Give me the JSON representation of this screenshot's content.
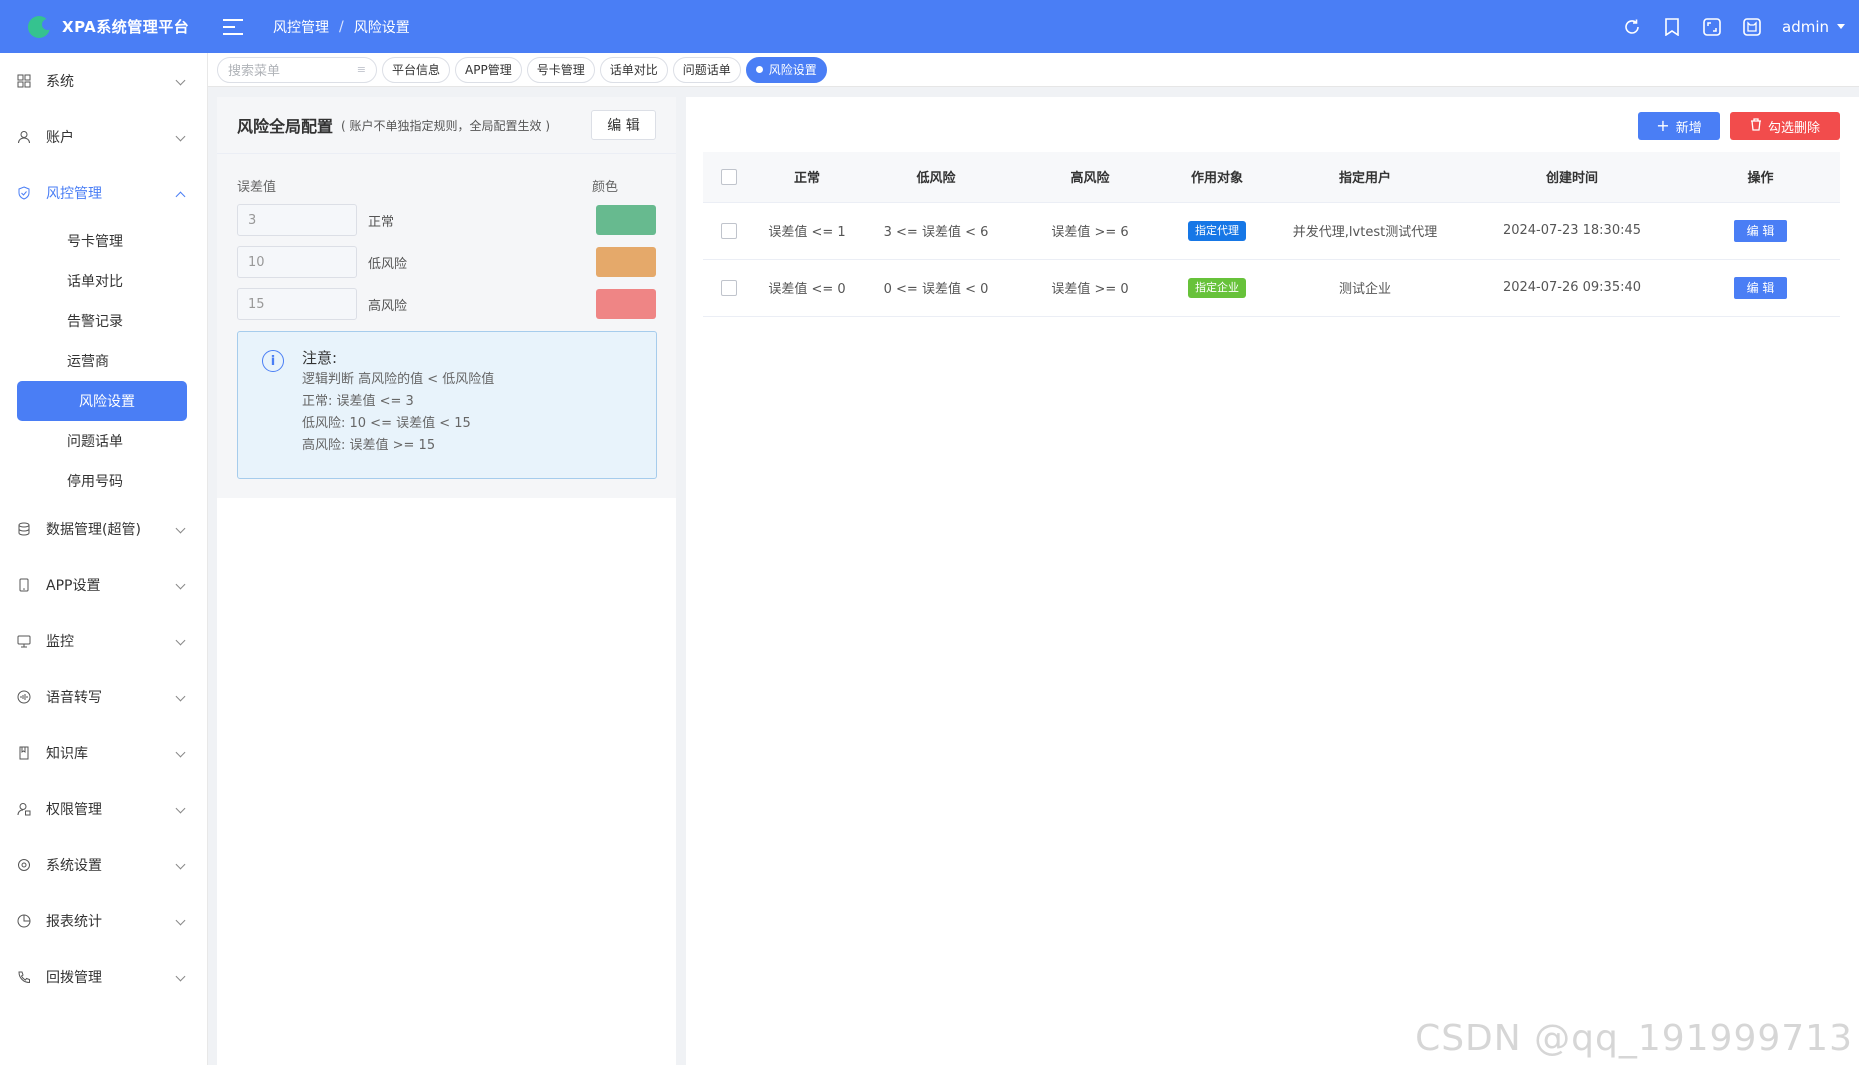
{
  "app": {
    "title": "XPA系统管理平台",
    "brand_color": "#4a7ef5"
  },
  "breadcrumb": [
    "风控管理",
    "风险设置"
  ],
  "header": {
    "user": "admin",
    "icons": [
      "refresh-icon",
      "bookmark-icon",
      "fullscreen-icon",
      "theme-icon"
    ]
  },
  "sidebar": {
    "items": [
      {
        "label": "系统",
        "icon": "grid-icon"
      },
      {
        "label": "账户",
        "icon": "user-icon"
      },
      {
        "label": "风控管理",
        "icon": "shield-icon",
        "open": true,
        "children": [
          "号卡管理",
          "话单对比",
          "告警记录",
          "运营商",
          "风险设置",
          "问题话单",
          "停用号码"
        ],
        "active_child": "风险设置"
      },
      {
        "label": "数据管理(超管)",
        "icon": "database-icon"
      },
      {
        "label": "APP设置",
        "icon": "phone-icon"
      },
      {
        "label": "监控",
        "icon": "monitor-icon"
      },
      {
        "label": "语音转写",
        "icon": "voice-icon"
      },
      {
        "label": "知识库",
        "icon": "book-icon"
      },
      {
        "label": "权限管理",
        "icon": "user-lock-icon"
      },
      {
        "label": "系统设置",
        "icon": "settings-icon"
      },
      {
        "label": "报表统计",
        "icon": "pie-chart-icon"
      },
      {
        "label": "回拨管理",
        "icon": "phone-call-icon"
      }
    ]
  },
  "tabs": {
    "search_placeholder": "搜索菜单",
    "items": [
      "平台信息",
      "APP管理",
      "号卡管理",
      "话单对比",
      "问题话单",
      "风险设置"
    ],
    "active": "风险设置"
  },
  "config": {
    "title": "风险全局配置",
    "subtitle": "( 账户不单独指定规则，全局配置生效 )",
    "edit_label": "编 辑",
    "col_value": "误差值",
    "col_color": "颜色",
    "rows": [
      {
        "value": "3",
        "label": "正常",
        "color": "#67ba8f"
      },
      {
        "value": "10",
        "label": "低风险",
        "color": "#e5a96a"
      },
      {
        "value": "15",
        "label": "高风险",
        "color": "#ef8585"
      }
    ],
    "note": {
      "title": "注意:",
      "lines": [
        "逻辑判断 高风险的值 < 低风险值",
        "正常: 误差值 <= 3",
        "低风险: 10 <= 误差值 < 15",
        "高风险: 误差值 >= 15"
      ]
    }
  },
  "toolbar": {
    "add_label": "新增",
    "delete_label": "勾选删除"
  },
  "table": {
    "headers": [
      "正常",
      "低风险",
      "高风险",
      "作用对象",
      "指定用户",
      "创建时间",
      "操作"
    ],
    "rows": [
      {
        "normal": "误差值 <= 1",
        "low": "3 <= 误差值 < 6",
        "high": "误差值 >= 6",
        "target": "指定代理",
        "target_color": "#1677e6",
        "user": "并发代理,lvtest测试代理",
        "created": "2024-07-23 18:30:45",
        "action": "编 辑"
      },
      {
        "normal": "误差值 <= 0",
        "low": "0 <= 误差值 < 0",
        "high": "误差值 >= 0",
        "target": "指定企业",
        "target_color": "#67c23a",
        "user": "测试企业",
        "created": "2024-07-26 09:35:40",
        "action": "编 辑"
      }
    ]
  },
  "watermark": "CSDN @qq_191999713"
}
